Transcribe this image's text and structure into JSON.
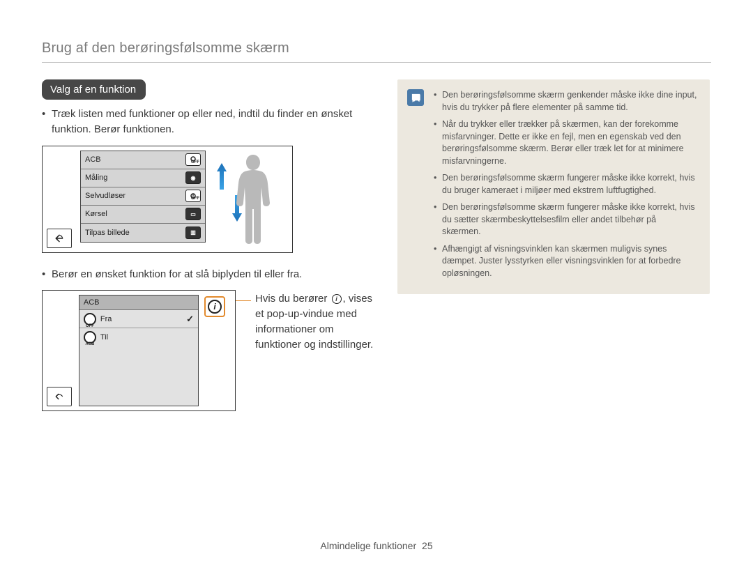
{
  "page_title": "Brug af den berøringsfølsomme skærm",
  "heading": "Valg af en funktion",
  "bullets_a": [
    "Træk listen med funktioner op eller ned, indtil du finder en ønsket funktion. Berør funktionen."
  ],
  "bullets_b": [
    "Berør en ønsket funktion for at slå biplyden til eller fra."
  ],
  "menu_items": [
    "ACB",
    "Måling",
    "Selvudløser",
    "Kørsel",
    "Tilpas billede"
  ],
  "acb_panel": {
    "title": "ACB",
    "off": "Fra",
    "on": "Til"
  },
  "callout": "Hvis du berører ⓘ, vises et pop-up-vindue med informationer om funktioner og indstillinger.",
  "callout_before": "Hvis du berører",
  "callout_after": ", vises et pop-up-vindue med informationer om funktioner og indstillinger.",
  "notes": [
    "Den berøringsfølsomme skærm genkender måske ikke dine input, hvis du trykker på flere elementer på samme tid.",
    "Når du trykker eller trækker på skærmen, kan der forekomme misfarvninger. Dette er ikke en fejl, men en egenskab ved den berøringsfølsomme skærm. Berør eller træk let for at minimere misfarvningerne.",
    "Den berøringsfølsomme skærm fungerer måske ikke korrekt, hvis du bruger kameraet i miljøer med ekstrem luftfugtighed.",
    "Den berøringsfølsomme skærm fungerer måske ikke korrekt, hvis du sætter skærmbeskyttelsesfilm eller andet tilbehør på skærmen.",
    "Afhængigt af visningsvinklen kan skærmen muligvis synes dæmpet. Juster lysstyrken eller visningsvinklen for at forbedre opløsningen."
  ],
  "footer": {
    "section": "Almindelige funktioner",
    "page": "25"
  }
}
